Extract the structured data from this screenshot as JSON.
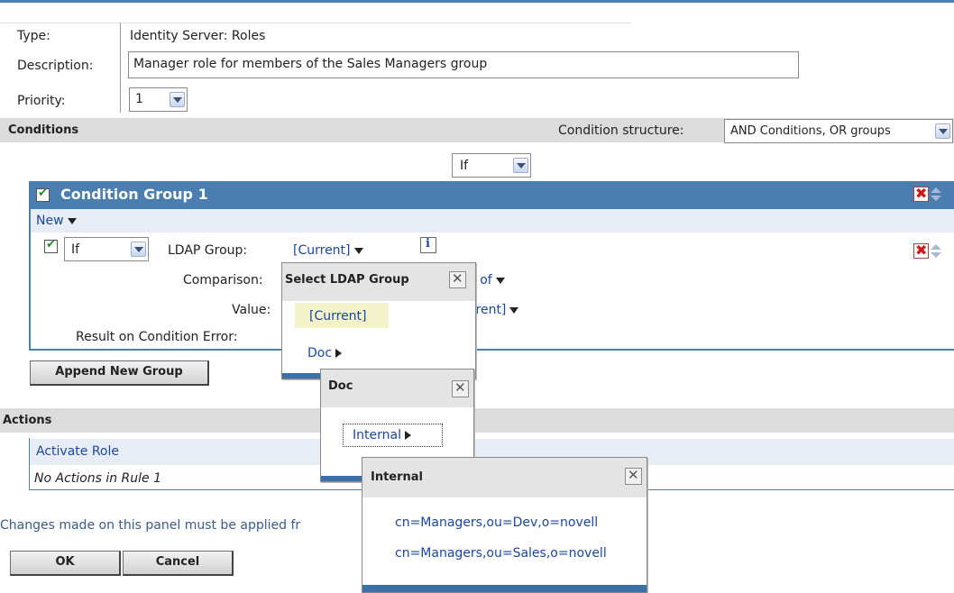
{
  "form": {
    "type_label": "Type:",
    "type_value": "Identity Server: Roles",
    "description_label": "Description:",
    "description_value": "Manager role for members of the Sales Managers group",
    "priority_label": "Priority:",
    "priority_value": "1"
  },
  "conditions": {
    "heading": "Conditions",
    "structure_label": "Condition structure:",
    "structure_value": "AND Conditions, OR groups",
    "group_operator": "If",
    "group": {
      "title": "Condition Group 1",
      "new_label": "New",
      "condition": {
        "operator": "If",
        "ldap_group_label": "LDAP Group:",
        "ldap_group_value": "[Current]",
        "comparison_label": "Comparison:",
        "comparison_value_fragment": "r of",
        "value_label": "Value:",
        "value_fragment": "rrent]",
        "result_error_label": "Result on Condition Error:"
      }
    },
    "append_group_button": "Append New Group"
  },
  "actions": {
    "heading": "Actions",
    "activate_role": "Activate Role",
    "no_actions": "No Actions in Rule 1"
  },
  "footer": {
    "note_fragment": "Changes made on this panel must be applied fr",
    "ok_button": "OK",
    "cancel_button": "Cancel"
  },
  "popups": {
    "select_ldap": {
      "title": "Select LDAP Group",
      "items": [
        "[Current]",
        "Doc"
      ]
    },
    "doc": {
      "title": "Doc",
      "items": [
        "Internal"
      ]
    },
    "internal": {
      "title": "Internal",
      "items": [
        "cn=Managers,ou=Dev,o=novell",
        "cn=Managers,ou=Sales,o=novell"
      ]
    }
  },
  "colors": {
    "accent_blue": "#4a7eb0",
    "group_header": "#4a7eb0",
    "selected_item": "#f4f2c8",
    "delete_red": "#d01818"
  }
}
